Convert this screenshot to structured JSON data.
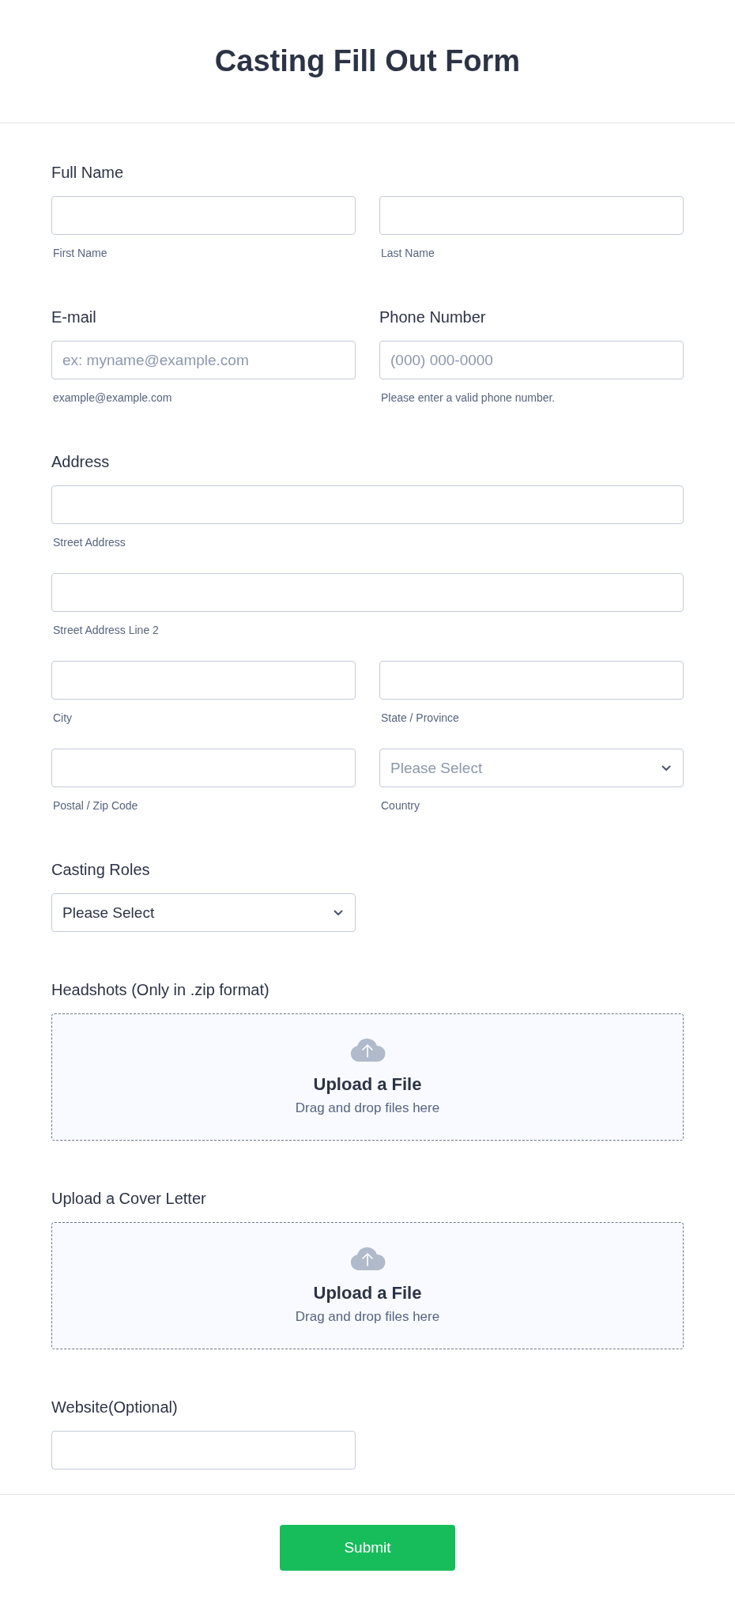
{
  "title": "Casting Fill Out Form",
  "sections": [
    {
      "kind": "fields",
      "label": "Full Name",
      "rows": [
        [
          {
            "kind": "text",
            "wide": false,
            "sublabel": "First Name"
          },
          {
            "kind": "text",
            "wide": false,
            "sublabel": "Last Name"
          }
        ]
      ]
    },
    {
      "kind": "pair",
      "columns": [
        {
          "label": "E-mail",
          "field": {
            "placeholder": "ex: myname@example.com",
            "sublabel": "example@example.com"
          }
        },
        {
          "label": "Phone Number",
          "field": {
            "placeholder": "(000) 000-0000",
            "sublabel": "Please enter a valid phone number."
          }
        }
      ]
    },
    {
      "kind": "fields",
      "label": "Address",
      "rows": [
        [
          {
            "kind": "text",
            "wide": true,
            "sublabel": "Street Address"
          }
        ],
        [
          {
            "kind": "text",
            "wide": true,
            "sublabel": "Street Address Line 2"
          }
        ],
        [
          {
            "kind": "text",
            "wide": false,
            "sublabel": "City"
          },
          {
            "kind": "text",
            "wide": false,
            "sublabel": "State / Province"
          }
        ],
        [
          {
            "kind": "text",
            "wide": false,
            "sublabel": "Postal / Zip Code"
          },
          {
            "kind": "select",
            "wide": false,
            "placeholder": "Please Select",
            "sublabel": "Country"
          }
        ]
      ]
    },
    {
      "kind": "fields",
      "label": "Casting Roles",
      "rows": [
        [
          {
            "kind": "select",
            "wide": false,
            "value": "Please Select"
          }
        ]
      ]
    },
    {
      "kind": "upload",
      "label": "Headshots (Only in .zip format)",
      "title": "Upload a File",
      "hint": "Drag and drop files here"
    },
    {
      "kind": "upload",
      "label": "Upload a Cover Letter",
      "title": "Upload a File",
      "hint": "Drag and drop files here"
    },
    {
      "kind": "fields",
      "label": "Website(Optional)",
      "rows": [
        [
          {
            "kind": "text",
            "wide": false
          }
        ]
      ]
    }
  ],
  "submit": "Submit"
}
